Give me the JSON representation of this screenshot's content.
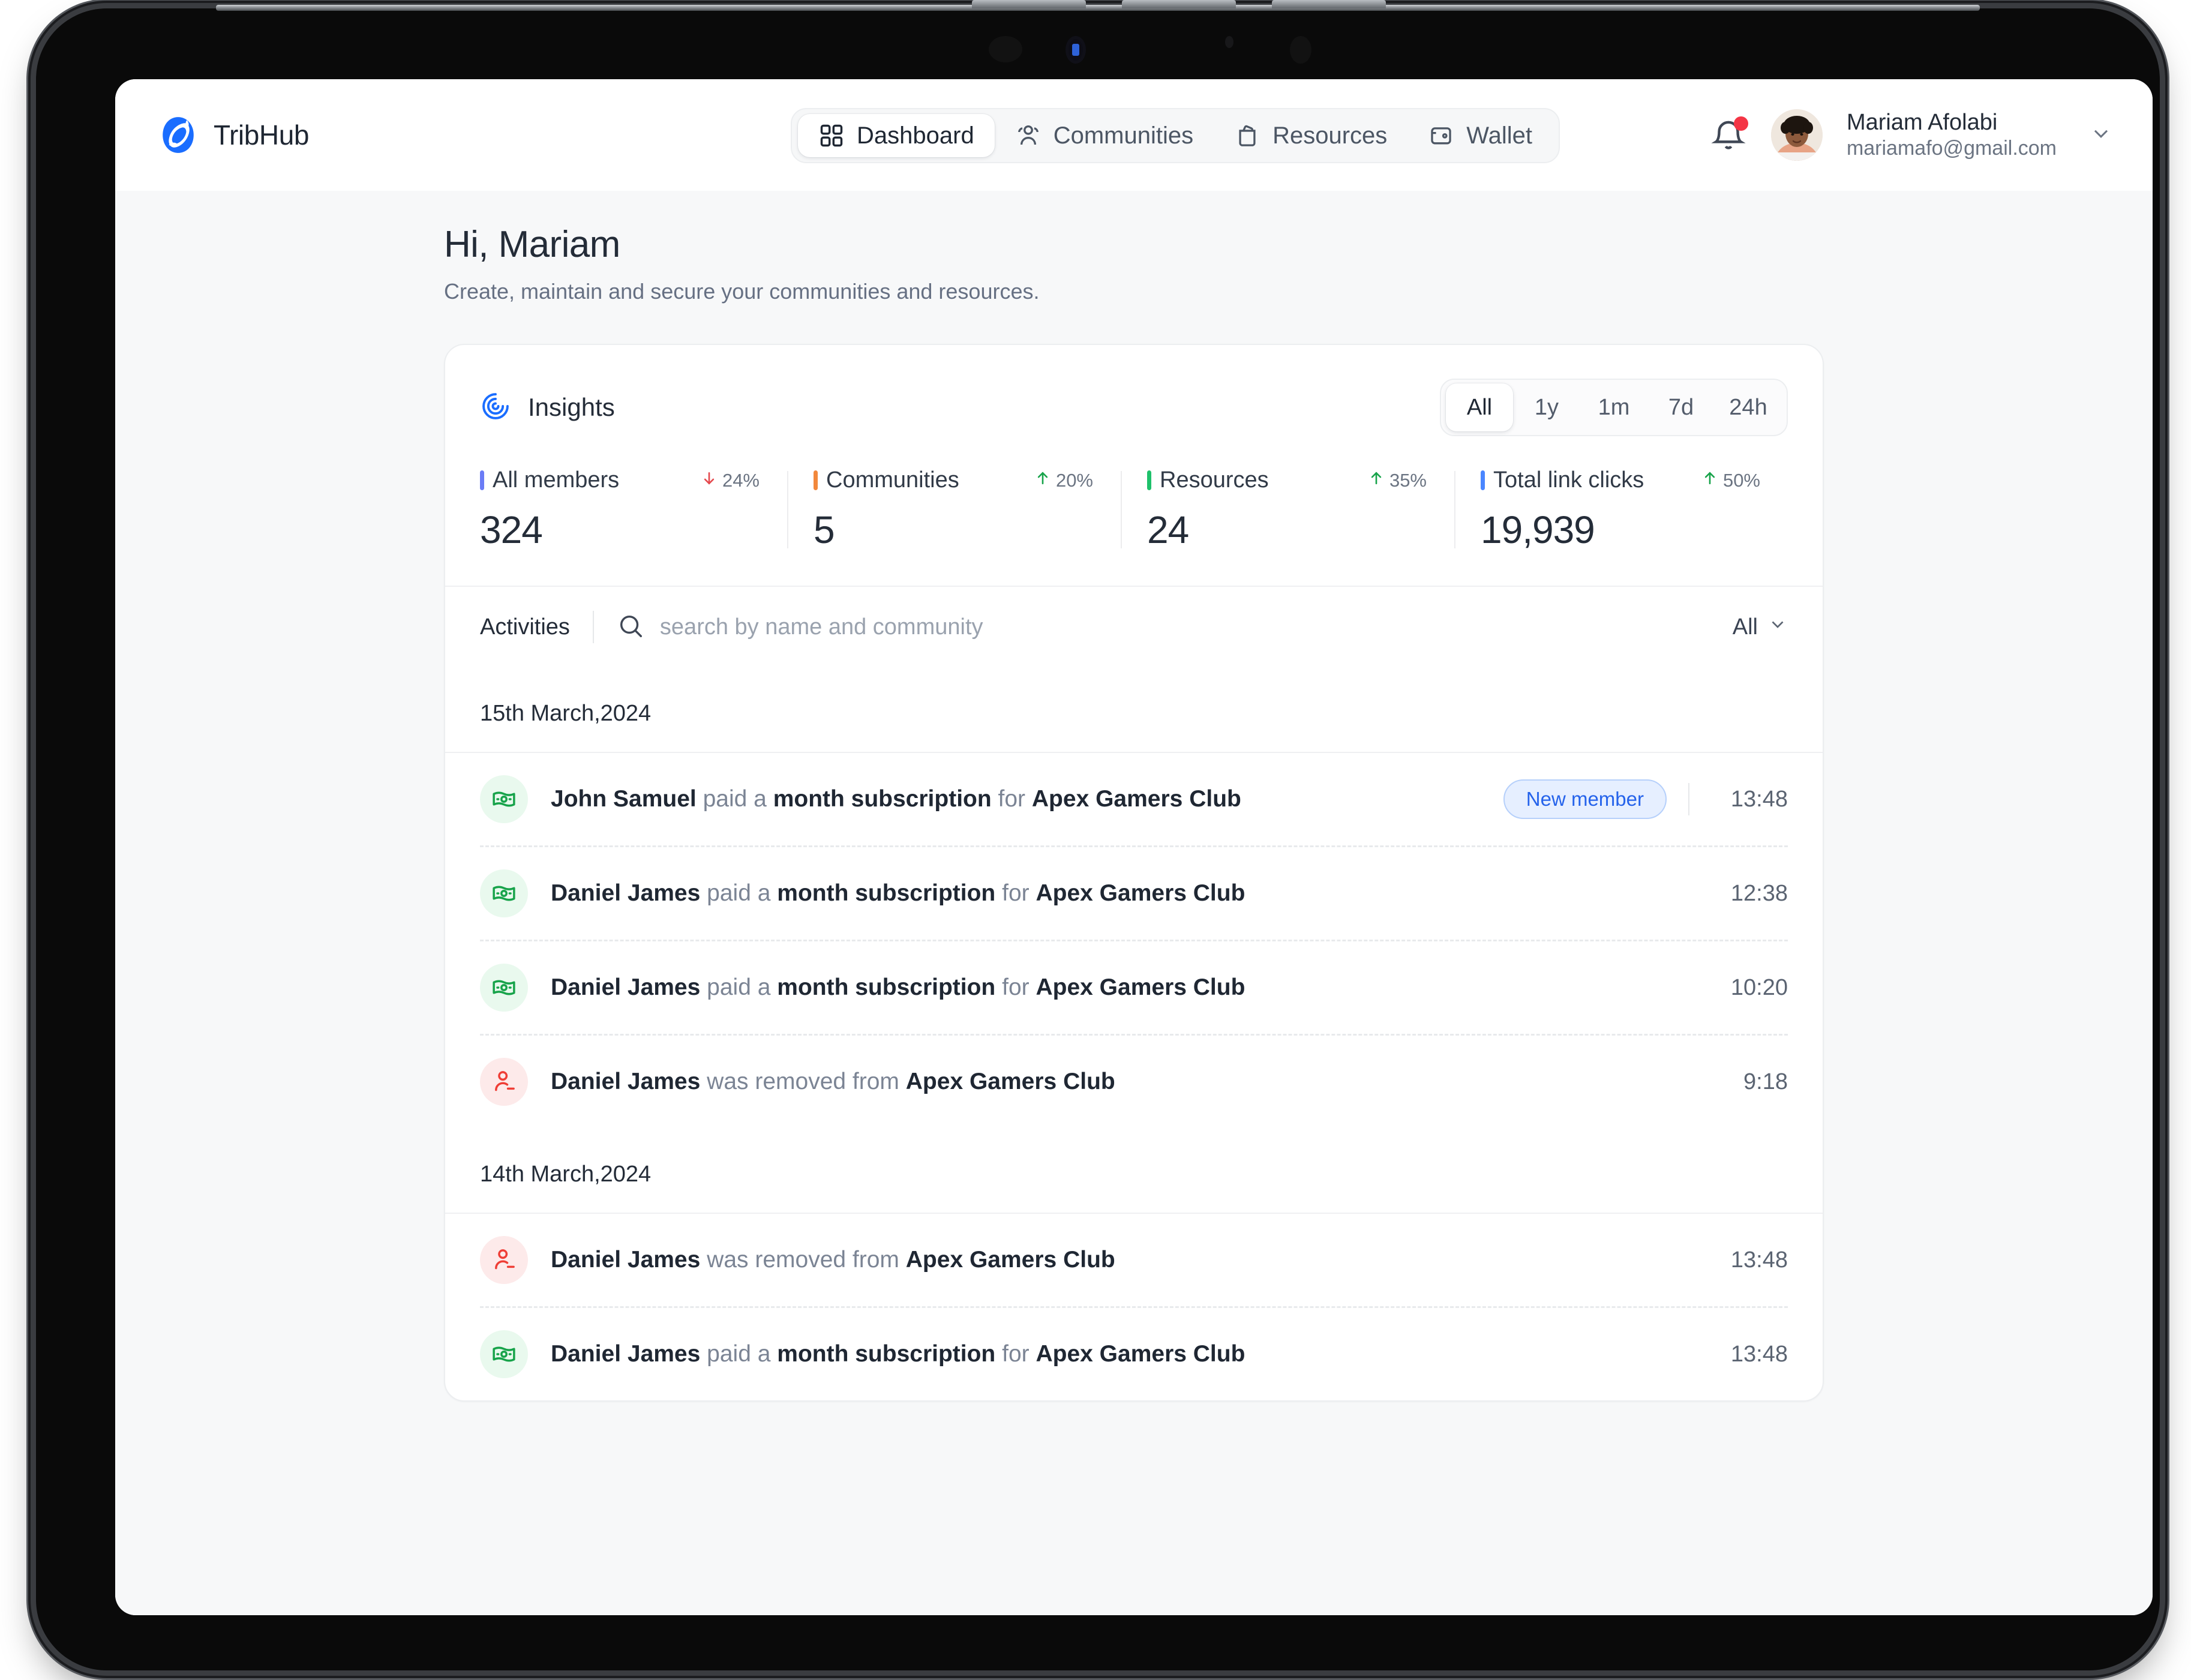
{
  "brand": {
    "name": "TribHub",
    "logo_icon": "tribhub-logo-icon",
    "color": "#1a6dff"
  },
  "nav": {
    "tabs": [
      {
        "label": "Dashboard",
        "icon": "grid-icon",
        "active": true
      },
      {
        "label": "Communities",
        "icon": "users-icon",
        "active": false
      },
      {
        "label": "Resources",
        "icon": "folder-icon",
        "active": false
      },
      {
        "label": "Wallet",
        "icon": "wallet-icon",
        "active": false
      }
    ]
  },
  "user": {
    "name": "Mariam Afolabi",
    "email": "mariamafo@gmail.com",
    "notification_icon": "bell-icon",
    "has_notification": true,
    "caret_icon": "chevron-down-icon",
    "avatar_icon": "avatar"
  },
  "greeting": {
    "title": "Hi, Mariam",
    "subtitle": "Create, maintain and secure your communities and resources."
  },
  "insights": {
    "title": "Insights",
    "icon": "insights-spiral-icon",
    "ranges": [
      {
        "label": "All",
        "active": true
      },
      {
        "label": "1y",
        "active": false
      },
      {
        "label": "1m",
        "active": false
      },
      {
        "label": "7d",
        "active": false
      },
      {
        "label": "24h",
        "active": false
      }
    ],
    "stats": [
      {
        "label": "All members",
        "value": "324",
        "delta": "24%",
        "direction": "down",
        "accent": "#6b7cf6",
        "delta_color": "#e5484d"
      },
      {
        "label": "Communities",
        "value": "5",
        "delta": "20%",
        "direction": "up",
        "accent": "#f2883c",
        "delta_color": "#17a34a"
      },
      {
        "label": "Resources",
        "value": "24",
        "delta": "35%",
        "direction": "up",
        "accent": "#1fc16b",
        "delta_color": "#17a34a"
      },
      {
        "label": "Total link clicks",
        "value": "19,939",
        "delta": "50%",
        "direction": "up",
        "accent": "#4a86ff",
        "delta_color": "#17a34a"
      }
    ]
  },
  "activities": {
    "title": "Activities",
    "search_placeholder": "search by name and community",
    "search_value": "",
    "search_icon": "search-icon",
    "filter_label": "All",
    "filter_icon": "chevron-down-icon",
    "groups": [
      {
        "date": "15th March,2024",
        "rows": [
          {
            "icon": "banknote-icon",
            "kind": "pay",
            "actor": "John Samuel",
            "verb": "paid a",
            "object": "month subscription",
            "prep": "for",
            "target": "Apex Gamers Club",
            "badge": "New member",
            "time": "13:48"
          },
          {
            "icon": "banknote-icon",
            "kind": "pay",
            "actor": "Daniel James",
            "verb": "paid a",
            "object": "month subscription",
            "prep": "for",
            "target": "Apex Gamers Club",
            "badge": "",
            "time": "12:38"
          },
          {
            "icon": "banknote-icon",
            "kind": "pay",
            "actor": "Daniel James",
            "verb": "paid a",
            "object": "month subscription",
            "prep": "for",
            "target": "Apex Gamers Club",
            "badge": "",
            "time": "10:20"
          },
          {
            "icon": "user-remove-icon",
            "kind": "remove",
            "actor": "Daniel James",
            "verb": "was removed from",
            "object": "",
            "prep": "",
            "target": "Apex Gamers Club",
            "badge": "",
            "time": "9:18"
          }
        ]
      },
      {
        "date": "14th March,2024",
        "rows": [
          {
            "icon": "user-remove-icon",
            "kind": "remove",
            "actor": "Daniel James",
            "verb": "was removed from",
            "object": "",
            "prep": "",
            "target": "Apex Gamers Club",
            "badge": "",
            "time": "13:48"
          },
          {
            "icon": "banknote-icon",
            "kind": "pay",
            "actor": "Daniel James",
            "verb": "paid a",
            "object": "month subscription",
            "prep": "for",
            "target": "Apex Gamers Club",
            "badge": "",
            "time": "13:48"
          }
        ]
      }
    ]
  }
}
